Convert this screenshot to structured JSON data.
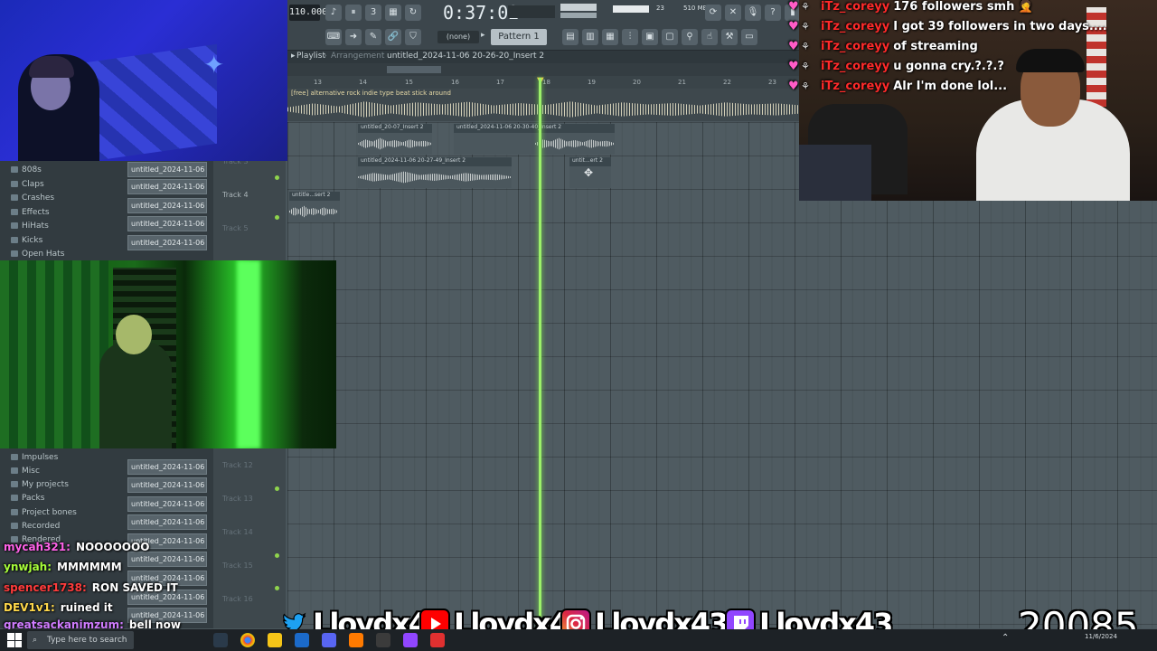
{
  "daw": {
    "tempo": "110.000",
    "time": "0:37:02",
    "cpu_num1": "23",
    "cpu_num2": "510 MB",
    "snap": "(none)",
    "pattern": "Pattern 1",
    "playlist_title": "Playlist",
    "playlist_sep": "›",
    "arrangement": "Arrangement",
    "arrangement_name": "untitled_2024-11-06 20-26-20_Insert 2",
    "ruler": [
      "13",
      "14",
      "15",
      "16",
      "17",
      "18",
      "19",
      "20",
      "21",
      "22",
      "23"
    ],
    "track1_label": "[free] alternative rock  indie type beat stick around",
    "clips": [
      {
        "label": "untitled_20-07_Insert 2"
      },
      {
        "label": "untitled_2024-11-06 20-30-40_Insert 2"
      },
      {
        "label": "untitled_2024-11-06 20-27-49_Insert 2"
      },
      {
        "label": "untit...ert 2"
      },
      {
        "label": "untitle...sert 2"
      }
    ],
    "track_labels": [
      {
        "text": "Track 3",
        "dim": true
      },
      {
        "text": "Track 4",
        "dim": false
      },
      {
        "text": "Track 5",
        "dim": true
      },
      {
        "text": "Track 12",
        "dim": true
      },
      {
        "text": "Track 13",
        "dim": true
      },
      {
        "text": "Track 14",
        "dim": true
      },
      {
        "text": "Track 15",
        "dim": true
      },
      {
        "text": "Track 16",
        "dim": true
      }
    ]
  },
  "browser": {
    "folders_top": [
      "808s",
      "Claps",
      "Crashes",
      "Effects",
      "HiHats",
      "Kicks",
      "Open Hats"
    ],
    "folders_bottom": [
      "Impulses",
      "Misc",
      "My projects",
      "Packs",
      "Project bones",
      "Recorded",
      "Rendered"
    ],
    "file_label": "untitled_2024-11-06 20-"
  },
  "chat_top": [
    {
      "user": "iTz_coreyy",
      "msg": "176 followers smh 🤦"
    },
    {
      "user": "iTz_coreyy",
      "msg": "I got 39 followers in two days...."
    },
    {
      "user": "iTz_coreyy",
      "msg": "of streaming"
    },
    {
      "user": "iTz_coreyy",
      "msg": "u gonna cry.?.?.?"
    },
    {
      "user": "iTz_coreyy",
      "msg": "Alr I'm done lol..."
    }
  ],
  "chat_bottom": [
    {
      "user": "mycah321:",
      "msg": "NOOOOOOO",
      "color": "#ff62e8"
    },
    {
      "user": "ynwjah:",
      "msg": "MMMMMM",
      "color": "#a8ff3a"
    },
    {
      "user": "spencer1738:",
      "msg": "RON SAVED IT",
      "color": "#ff3b3b"
    },
    {
      "user": "DEV1v1:",
      "msg": "ruined it",
      "color": "#ffd84a"
    },
    {
      "user": "greatsackanimzum:",
      "msg": "bell now",
      "color": "#d07cff"
    }
  ],
  "socials": [
    {
      "platform": "twitter-icon",
      "name": "Lloydx43",
      "color": "#1da1f2"
    },
    {
      "platform": "youtube-icon",
      "name": "Lloydx43",
      "color": "#ff0000"
    },
    {
      "platform": "instagram-icon",
      "name": "Lloydx43",
      "color": "#d6249f"
    },
    {
      "platform": "twitch-icon",
      "name": "Lloydx43",
      "color": "#9146ff"
    }
  ],
  "counter": "20085",
  "taskbar": {
    "search_placeholder": "Type here to search",
    "date": "11/6/2024"
  }
}
